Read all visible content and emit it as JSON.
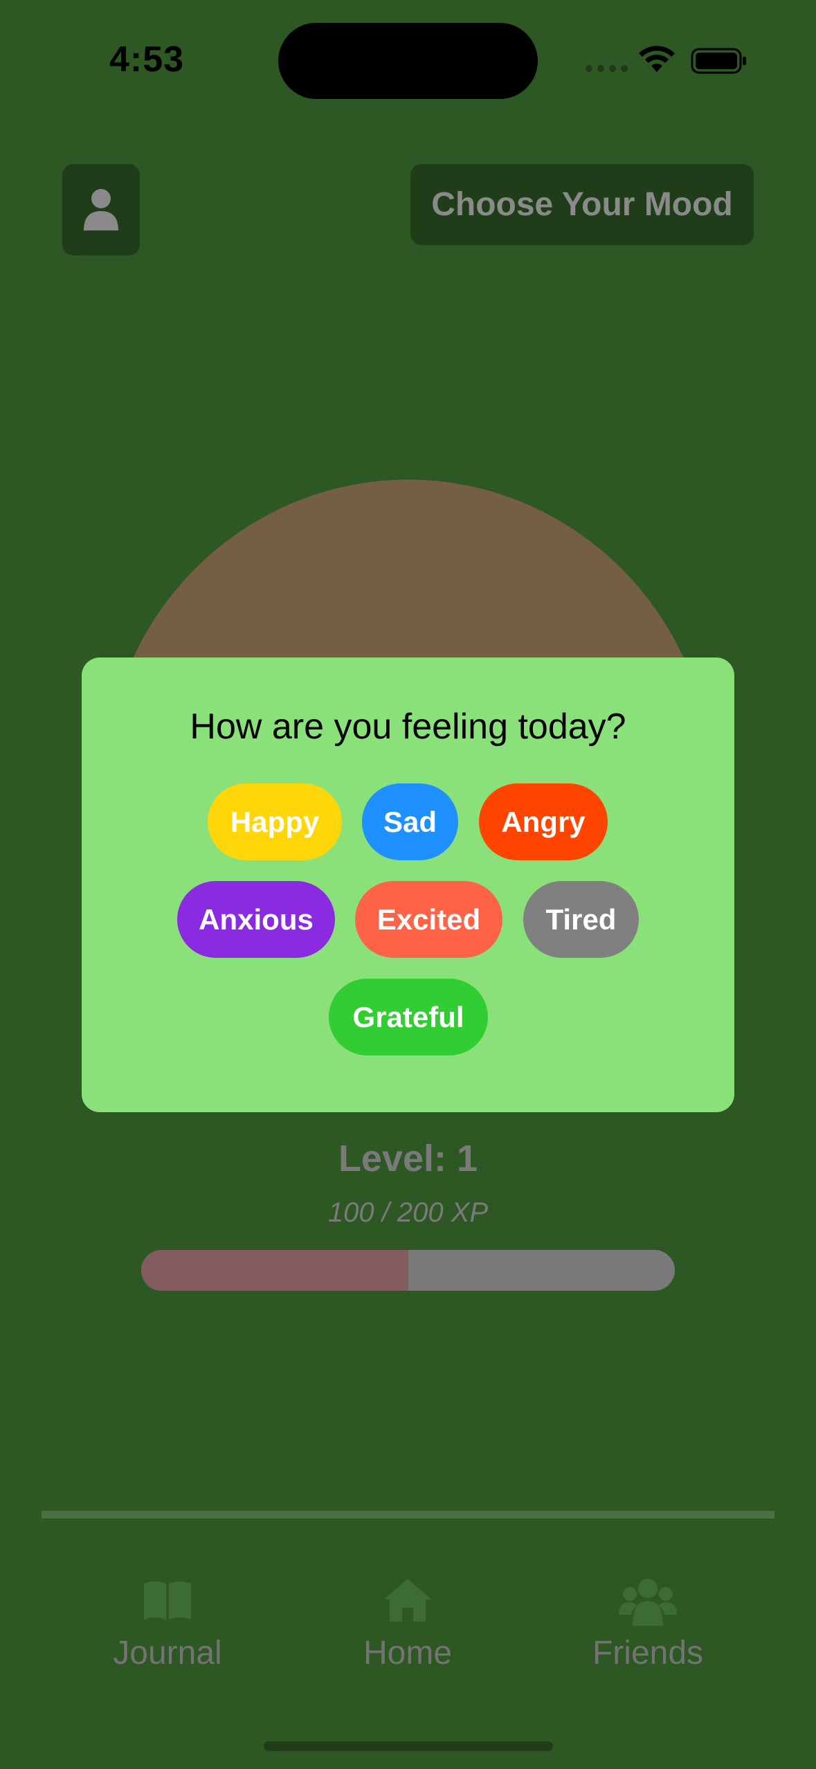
{
  "status_bar": {
    "time": "4:53",
    "icons": [
      "signal-icon",
      "wifi-icon",
      "battery-icon"
    ]
  },
  "header": {
    "profile_icon": "person-icon",
    "mood_button_label": "Choose Your Mood"
  },
  "modal": {
    "title": "How are you feeling today?",
    "moods": [
      {
        "label": "Happy",
        "color": "#ffd60a"
      },
      {
        "label": "Sad",
        "color": "#1e90ff"
      },
      {
        "label": "Angry",
        "color": "#ff4500"
      },
      {
        "label": "Anxious",
        "color": "#8a2be2"
      },
      {
        "label": "Excited",
        "color": "#ff6347"
      },
      {
        "label": "Tired",
        "color": "#808080"
      },
      {
        "label": "Grateful",
        "color": "#32cd32"
      }
    ]
  },
  "progress": {
    "level_label": "Level: 1",
    "xp_label": "100 / 200 XP",
    "xp_fraction": 0.5
  },
  "tab_bar": {
    "tabs": [
      {
        "label": "Journal",
        "icon": "book-icon"
      },
      {
        "label": "Home",
        "icon": "house-icon"
      },
      {
        "label": "Friends",
        "icon": "people-icon"
      }
    ]
  },
  "colors": {
    "background": "#2d5723",
    "modal": "#8ae17a",
    "mound": "#745f43",
    "xp_fill": "#845c60",
    "xp_track": "#7a7a7a"
  }
}
